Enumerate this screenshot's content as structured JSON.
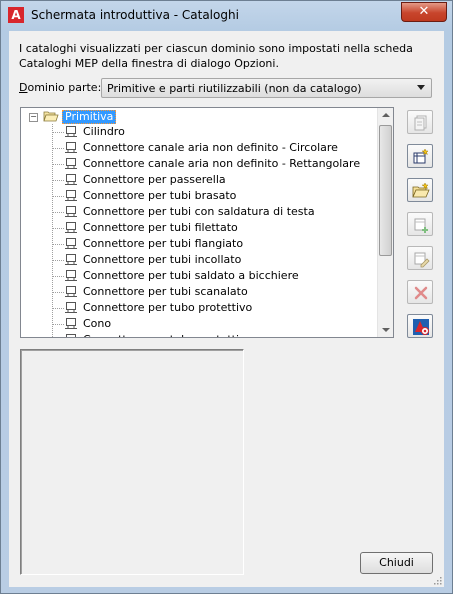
{
  "window": {
    "title": "Schermata introduttiva - Cataloghi",
    "close_glyph": "✕"
  },
  "description": "I cataloghi visualizzati per ciascun dominio sono impostati nella scheda Cataloghi MEP della finestra di dialogo Opzioni.",
  "domain": {
    "label_prefix": "",
    "label_access_key": "D",
    "label_rest": "ominio parte:",
    "selected": "Primitive e parti riutilizzabili (non da catalogo)"
  },
  "tree": {
    "root": "Primitiva",
    "items": [
      "Cilindro",
      "Connettore canale aria non definito - Circolare",
      "Connettore canale aria non definito - Rettangolare",
      "Connettore per passerella",
      "Connettore per tubi brasato",
      "Connettore per tubi con saldatura di testa",
      "Connettore per tubi filettato",
      "Connettore per tubi flangiato",
      "Connettore per tubi incollato",
      "Connettore per tubi saldato a bicchiere",
      "Connettore per tubi scanalato",
      "Connettore per tubo protettivo",
      "Cono",
      "Connettore per tubo protettivo..."
    ]
  },
  "toolbar": {
    "icons": [
      "catalog-properties-icon",
      "new-catalog-icon",
      "open-catalog-icon",
      "add-part-icon",
      "edit-part-icon",
      "delete-icon",
      "content-builder-icon"
    ]
  },
  "buttons": {
    "close": "Chiudi"
  },
  "colors": {
    "selection": "#3399ff",
    "delete_red": "#e03b3b",
    "accent_red": "#d8262c"
  }
}
